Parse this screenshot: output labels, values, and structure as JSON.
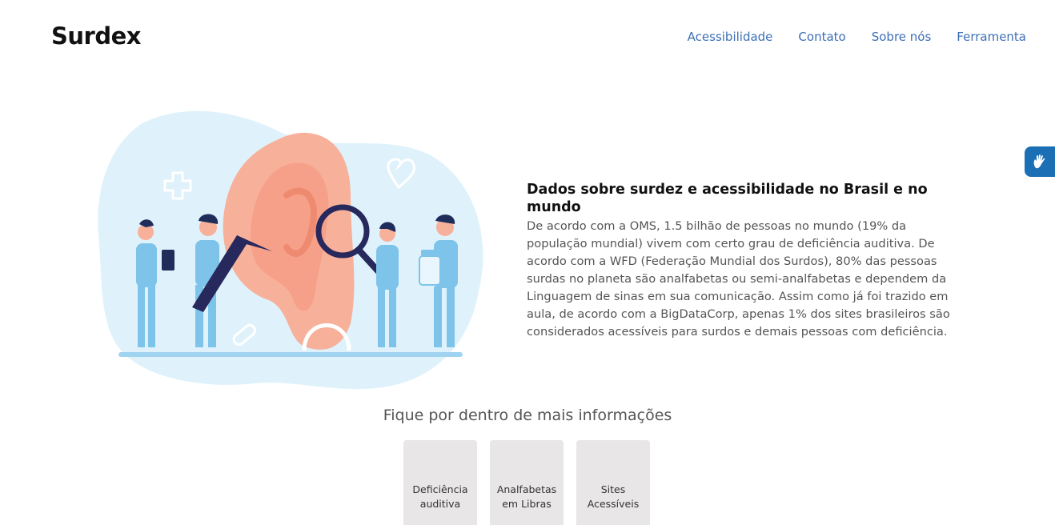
{
  "header": {
    "brand": "Surdex",
    "nav": [
      "Acessibilidade",
      "Contato",
      "Sobre nós",
      "Ferramenta"
    ]
  },
  "hero": {
    "title": "Dados sobre surdez e acessibilidade no Brasil e no mundo",
    "body": "De acordo com a OMS, 1.5 bilhão de pessoas no mundo (19% da população mundial) vivem com certo grau de deficiência auditiva. De acordo com a WFD (Federação Mundial dos Surdos), 80% das pessoas surdas no planeta são analfabetas ou semi-analfabetas e dependem da Linguagem de sinas em sua comunicação. Assim como já foi trazido em aula, de acordo com a BigDataCorp, apenas 1% dos sites brasileiros são considerados acessíveis para surdos e demais pessoas com deficiência."
  },
  "more": {
    "title": "Fique por dentro de mais informações",
    "cards": [
      {
        "line1": "Deficiência",
        "line2": "auditiva"
      },
      {
        "line1": "Analfabetas",
        "line2": "em Libras"
      },
      {
        "line1": "Sites",
        "line2": "Acessíveis"
      }
    ]
  },
  "colors": {
    "nav_link": "#3d6fb6",
    "libras_button": "#1a6fb5",
    "card_bg": "#e8e6e6",
    "blob": "#dff2fb",
    "ear": "#f7b09a"
  },
  "icons": {
    "libras": "hand-sign-icon"
  }
}
